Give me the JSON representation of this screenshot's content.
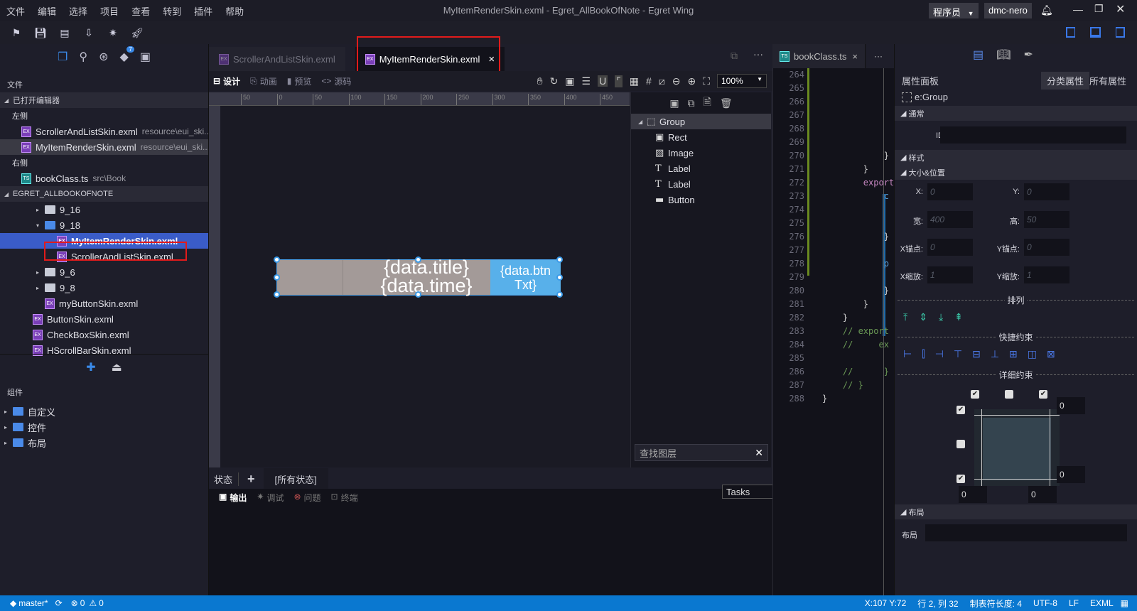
{
  "window": {
    "title": "MyItemRenderSkin.exml - Egret_AllBookOfNote - Egret Wing",
    "role_select": "程序员",
    "user": "dmc-nero",
    "menu": [
      "文件",
      "编辑",
      "选择",
      "项目",
      "查看",
      "转到",
      "插件",
      "帮助"
    ]
  },
  "toolbar": {
    "icons": [
      "new-project-icon",
      "save-icon",
      "save-all-icon",
      "publish-icon",
      "debug-bug-icon",
      "rocket-run-icon"
    ]
  },
  "sidebar": {
    "badge": "7",
    "header": "文件",
    "open_editors": "已打开编辑器",
    "left_group": "左侧",
    "right_group": "右侧",
    "open_left": [
      {
        "name": "ScrollerAndListSkin.exml",
        "path": "resource\\eui_ski..."
      },
      {
        "name": "MyItemRenderSkin.exml",
        "path": "resource\\eui_ski..."
      }
    ],
    "open_right": [
      {
        "name": "bookClass.ts",
        "path": "src\\Book"
      }
    ],
    "project": "EGRET_ALLBOOKOFNOTE",
    "tree": [
      {
        "type": "folder",
        "name": "9_16",
        "level": 3,
        "caret": "▸"
      },
      {
        "type": "folder-open",
        "name": "9_18",
        "level": 3,
        "caret": "▾"
      },
      {
        "type": "exml",
        "name": "MyItemRenderSkin.exml",
        "level": 4,
        "selected": true
      },
      {
        "type": "exml",
        "name": "ScrollerAndListSkin.exml",
        "level": 4
      },
      {
        "type": "folder",
        "name": "9_6",
        "level": 3,
        "caret": "▸"
      },
      {
        "type": "folder",
        "name": "9_8",
        "level": 3,
        "caret": "▸"
      },
      {
        "type": "exml",
        "name": "myButtonSkin.exml",
        "level": 3
      },
      {
        "type": "exml",
        "name": "ButtonSkin.exml",
        "level": 2
      },
      {
        "type": "exml",
        "name": "CheckBoxSkin.exml",
        "level": 2
      },
      {
        "type": "exml",
        "name": "HScrollBarSkin.exml",
        "level": 2
      }
    ],
    "components_header": "组件",
    "components": [
      "自定义",
      "控件",
      "布局"
    ]
  },
  "editor": {
    "tabs": [
      {
        "label": "ScrollerAndListSkin.exml",
        "active": false
      },
      {
        "label": "MyItemRenderSkin.exml",
        "active": true
      }
    ],
    "close": "×",
    "more": "···",
    "design_tabs": [
      "设计",
      "动画",
      "预览",
      "源码"
    ],
    "zoom": "100%",
    "ruler_ticks": [
      "50",
      "0",
      "50",
      "100",
      "150",
      "200",
      "250",
      "300",
      "350",
      "400",
      "450"
    ],
    "canvas": {
      "title": "{data.title}",
      "time": "{data.time}",
      "button": "{data.btn Txt}",
      "bg_color": "#a39a98",
      "button_color": "#58b0ea"
    },
    "layers": [
      {
        "label": "Group",
        "icon": "group-icon",
        "root": true
      },
      {
        "label": "Rect",
        "icon": "rect-icon"
      },
      {
        "label": "Image",
        "icon": "image-icon"
      },
      {
        "label": "Label",
        "icon": "label-t-icon"
      },
      {
        "label": "Label",
        "icon": "label-t-icon"
      },
      {
        "label": "Button",
        "icon": "button-icon"
      }
    ],
    "layer_search_placeholder": "查找图层",
    "states_label": "状态",
    "add_state": "+",
    "all_states": "[所有状态]"
  },
  "output": {
    "tabs": [
      "输出",
      "调试",
      "问题",
      "终端"
    ],
    "task_select": "Tasks"
  },
  "code": {
    "tab": "bookClass.ts",
    "lines": [
      {
        "n": "264",
        "t": ""
      },
      {
        "n": "265",
        "t": ""
      },
      {
        "n": "266",
        "t": ""
      },
      {
        "n": "267",
        "t": ""
      },
      {
        "n": "268",
        "t": ""
      },
      {
        "n": "269",
        "t": ""
      },
      {
        "n": "270",
        "t": "            }",
        "c": "#d4d4d4"
      },
      {
        "n": "271",
        "t": "        }",
        "c": "#d4d4d4"
      },
      {
        "n": "272",
        "t": "        export",
        "c": "#c586c0"
      },
      {
        "n": "273",
        "t": "            c",
        "c": "#569cd6"
      },
      {
        "n": "274",
        "t": ""
      },
      {
        "n": "275",
        "t": ""
      },
      {
        "n": "276",
        "t": "            }",
        "c": "#d4d4d4"
      },
      {
        "n": "277",
        "t": ""
      },
      {
        "n": "278",
        "t": "            p",
        "c": "#569cd6"
      },
      {
        "n": "279",
        "t": ""
      },
      {
        "n": "280",
        "t": "            }",
        "c": "#d4d4d4"
      },
      {
        "n": "281",
        "t": "        }",
        "c": "#d4d4d4"
      },
      {
        "n": "282",
        "t": "    }",
        "c": "#d4d4d4"
      },
      {
        "n": "283",
        "t": "    // export",
        "c": "#6a9955"
      },
      {
        "n": "284",
        "t": "    //     ex",
        "c": "#6a9955"
      },
      {
        "n": "285",
        "t": ""
      },
      {
        "n": "286",
        "t": "    //      }",
        "c": "#6a9955"
      },
      {
        "n": "287",
        "t": "    // }",
        "c": "#6a9955"
      },
      {
        "n": "288",
        "t": "}",
        "c": "#d4d4d4"
      }
    ]
  },
  "properties": {
    "title": "属性面板",
    "btn_category": "分类属性",
    "btn_all": "所有属性",
    "component": "e:Group",
    "sec_common": "通常",
    "id_label": "ID:",
    "sec_style": "样式",
    "sec_size": "大小&位置",
    "fields": [
      {
        "label": "X:",
        "value": "0"
      },
      {
        "label": "Y:",
        "value": "0"
      },
      {
        "label": "宽:",
        "value": "400"
      },
      {
        "label": "高:",
        "value": "50"
      },
      {
        "label": "X锚点:",
        "value": "0"
      },
      {
        "label": "Y锚点:",
        "value": "0"
      },
      {
        "label": "X缩放:",
        "value": "1"
      },
      {
        "label": "Y缩放:",
        "value": "1"
      }
    ],
    "arrange": "排列",
    "quick": "快捷约束",
    "detail": "详细约束",
    "constraint_values": {
      "top": "0",
      "bottom": "0",
      "left": "0",
      "right": "0"
    },
    "checks": {
      "left": true,
      "hcenter": false,
      "right": true,
      "top": true,
      "vcenter": false,
      "bottom": true
    },
    "sec_layout": "布局",
    "layout_label": "布局"
  },
  "statusbar": {
    "branch": "master*",
    "errors": "0",
    "warnings": "0",
    "coords": "X:107 Y:72",
    "position": "行 2, 列 32",
    "tab_size": "制表符长度: 4",
    "encoding": "UTF-8",
    "eol": "LF",
    "language": "EXML"
  }
}
